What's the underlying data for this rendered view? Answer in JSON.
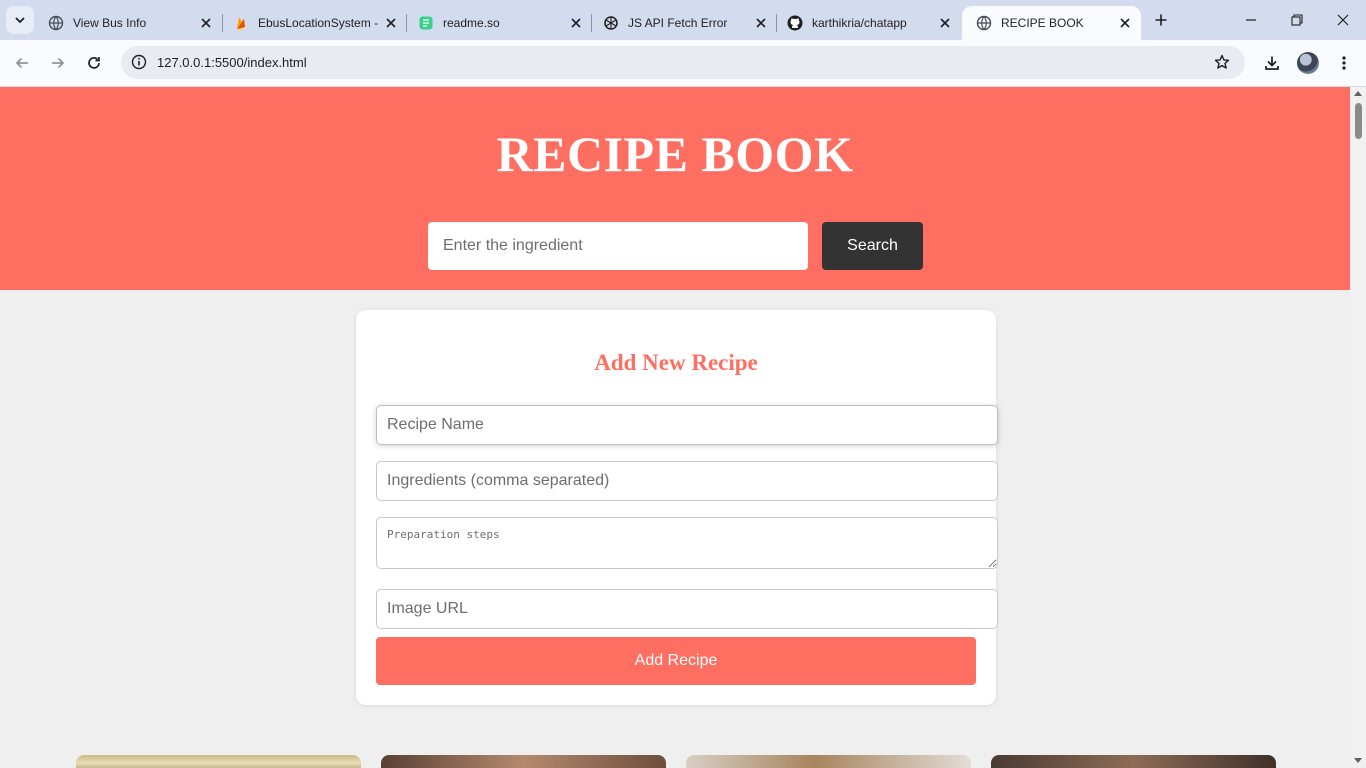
{
  "browser": {
    "tabs": [
      {
        "title": "View Bus Info",
        "favicon": "globe-icon",
        "active": false
      },
      {
        "title": "EbusLocationSystem -",
        "favicon": "firebase-icon",
        "active": false
      },
      {
        "title": "readme.so",
        "favicon": "readme-icon",
        "active": false
      },
      {
        "title": "JS API Fetch Error",
        "favicon": "openai-icon",
        "active": false
      },
      {
        "title": "karthikria/chatapp",
        "favicon": "github-icon",
        "active": false
      },
      {
        "title": "RECIPE BOOK",
        "favicon": "globe-icon",
        "active": true
      }
    ],
    "address": {
      "host": "127.0.0.1",
      "rest": ":5500/index.html"
    }
  },
  "page": {
    "title": "RECIPE BOOK",
    "search": {
      "placeholder": "Enter the ingredient",
      "button_label": "Search"
    },
    "form": {
      "heading": "Add New Recipe",
      "name_placeholder": "Recipe Name",
      "ingredients_placeholder": "Ingredients (comma separated)",
      "steps_placeholder": "Preparation steps",
      "image_placeholder": "Image URL",
      "submit_label": "Add Recipe"
    }
  },
  "colors": {
    "accent": "#ff6f61",
    "dark_button": "#333333",
    "page_bg": "#efefef"
  }
}
